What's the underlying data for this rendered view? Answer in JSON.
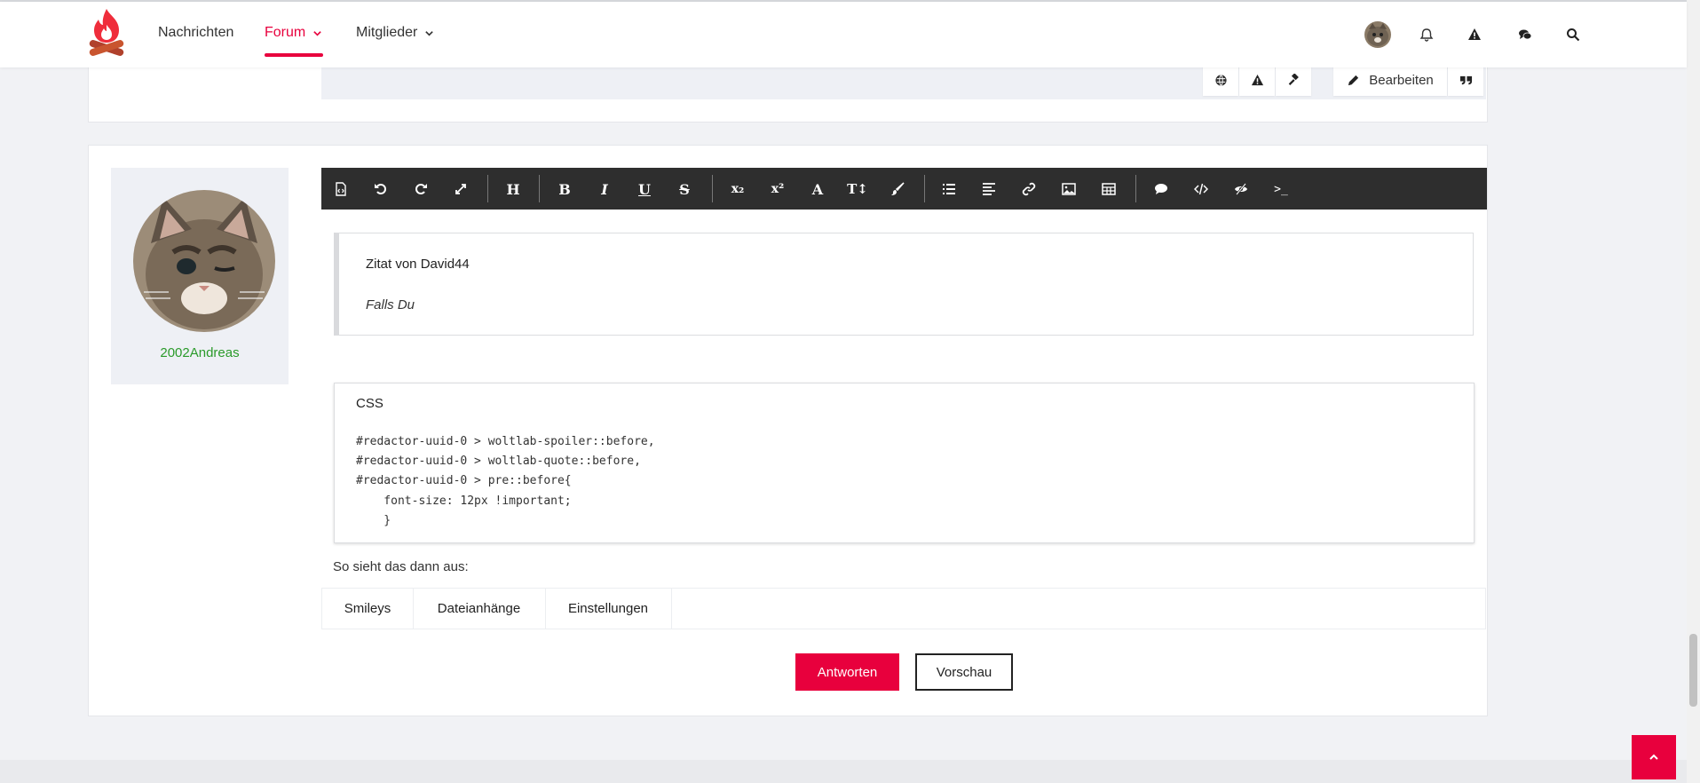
{
  "header": {
    "nav": [
      {
        "label": "Nachrichten"
      },
      {
        "label": "Forum"
      },
      {
        "label": "Mitglieder"
      }
    ],
    "accent": "#e8003d"
  },
  "previous_post": {
    "edit_label": "Bearbeiten"
  },
  "post": {
    "username": "2002Andreas",
    "quote": {
      "title": "Zitat von David44",
      "text": "Falls Du"
    },
    "code": {
      "language": "CSS",
      "lines": [
        "#redactor-uuid-0 > woltlab-spoiler::before,",
        "#redactor-uuid-0 > woltlab-quote::before,",
        "#redactor-uuid-0 > pre::before{",
        "    font-size: 12px !important;",
        "    }"
      ]
    },
    "text": "So sieht das dann aus:"
  },
  "editor_tabs": [
    {
      "label": "Smileys"
    },
    {
      "label": "Dateianhänge"
    },
    {
      "label": "Einstellungen"
    }
  ],
  "actions": {
    "submit_label": "Antworten",
    "preview_label": "Vorschau"
  },
  "toolbar": {
    "heading_glyph": "H",
    "bold_glyph": "B",
    "italic_glyph": "I",
    "underline_glyph": "U",
    "strike_glyph": "S",
    "sub_glyph": "x₂",
    "sup_glyph": "x²",
    "font_glyph": "A",
    "size_glyph": "T↕",
    "terminal_glyph": ">_"
  }
}
